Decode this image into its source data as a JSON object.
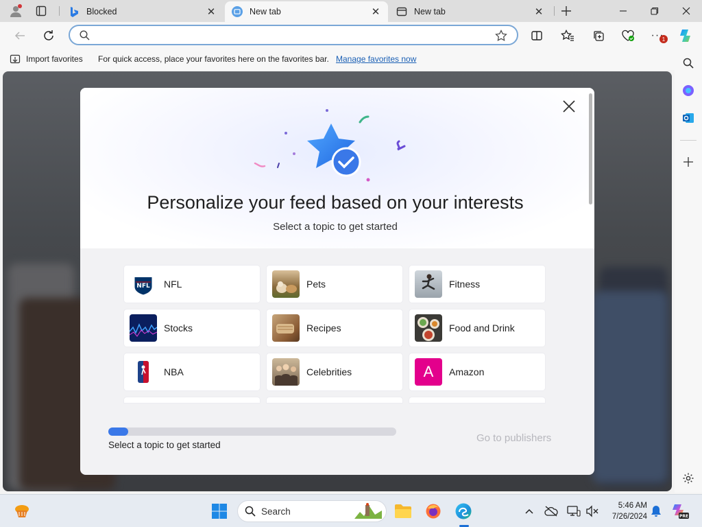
{
  "tabs": [
    {
      "label": "Blocked",
      "icon": "bing-icon",
      "active": false
    },
    {
      "label": "New tab",
      "icon": "new-tab-icon",
      "active": true
    },
    {
      "label": "New tab",
      "icon": "new-tab-icon",
      "active": false
    }
  ],
  "address": {
    "value": "",
    "placeholder": ""
  },
  "favorites_bar": {
    "import_label": "Import favorites",
    "hint": "For quick access, place your favorites here on the favorites bar.",
    "manage_link": "Manage favorites now"
  },
  "notifications_badge": "1",
  "modal": {
    "title": "Personalize your feed based on your interests",
    "subtitle": "Select a topic to get started",
    "topics": [
      {
        "name": "NFL",
        "icon": "nfl-logo"
      },
      {
        "name": "Pets",
        "icon": "pets-thumbnail"
      },
      {
        "name": "Fitness",
        "icon": "fitness-thumbnail"
      },
      {
        "name": "Stocks",
        "icon": "stocks-thumbnail"
      },
      {
        "name": "Recipes",
        "icon": "recipes-thumbnail"
      },
      {
        "name": "Food and Drink",
        "icon": "food-thumbnail"
      },
      {
        "name": "NBA",
        "icon": "nba-logo"
      },
      {
        "name": "Celebrities",
        "icon": "celebrities-thumbnail"
      },
      {
        "name": "Amazon",
        "icon": "amazon-letter-tile",
        "letter": "A"
      }
    ],
    "progress_label": "Select a topic to get started",
    "progress": 0.07,
    "go_button": "Go to publishers"
  },
  "taskbar": {
    "search_label": "Search",
    "time": "5:46 AM",
    "date": "7/26/2024"
  },
  "colors": {
    "accent": "#3a78e8",
    "amazon_tile": "#e3008c",
    "link": "#1a5fb4",
    "disabled_text": "#b7b7bd"
  }
}
